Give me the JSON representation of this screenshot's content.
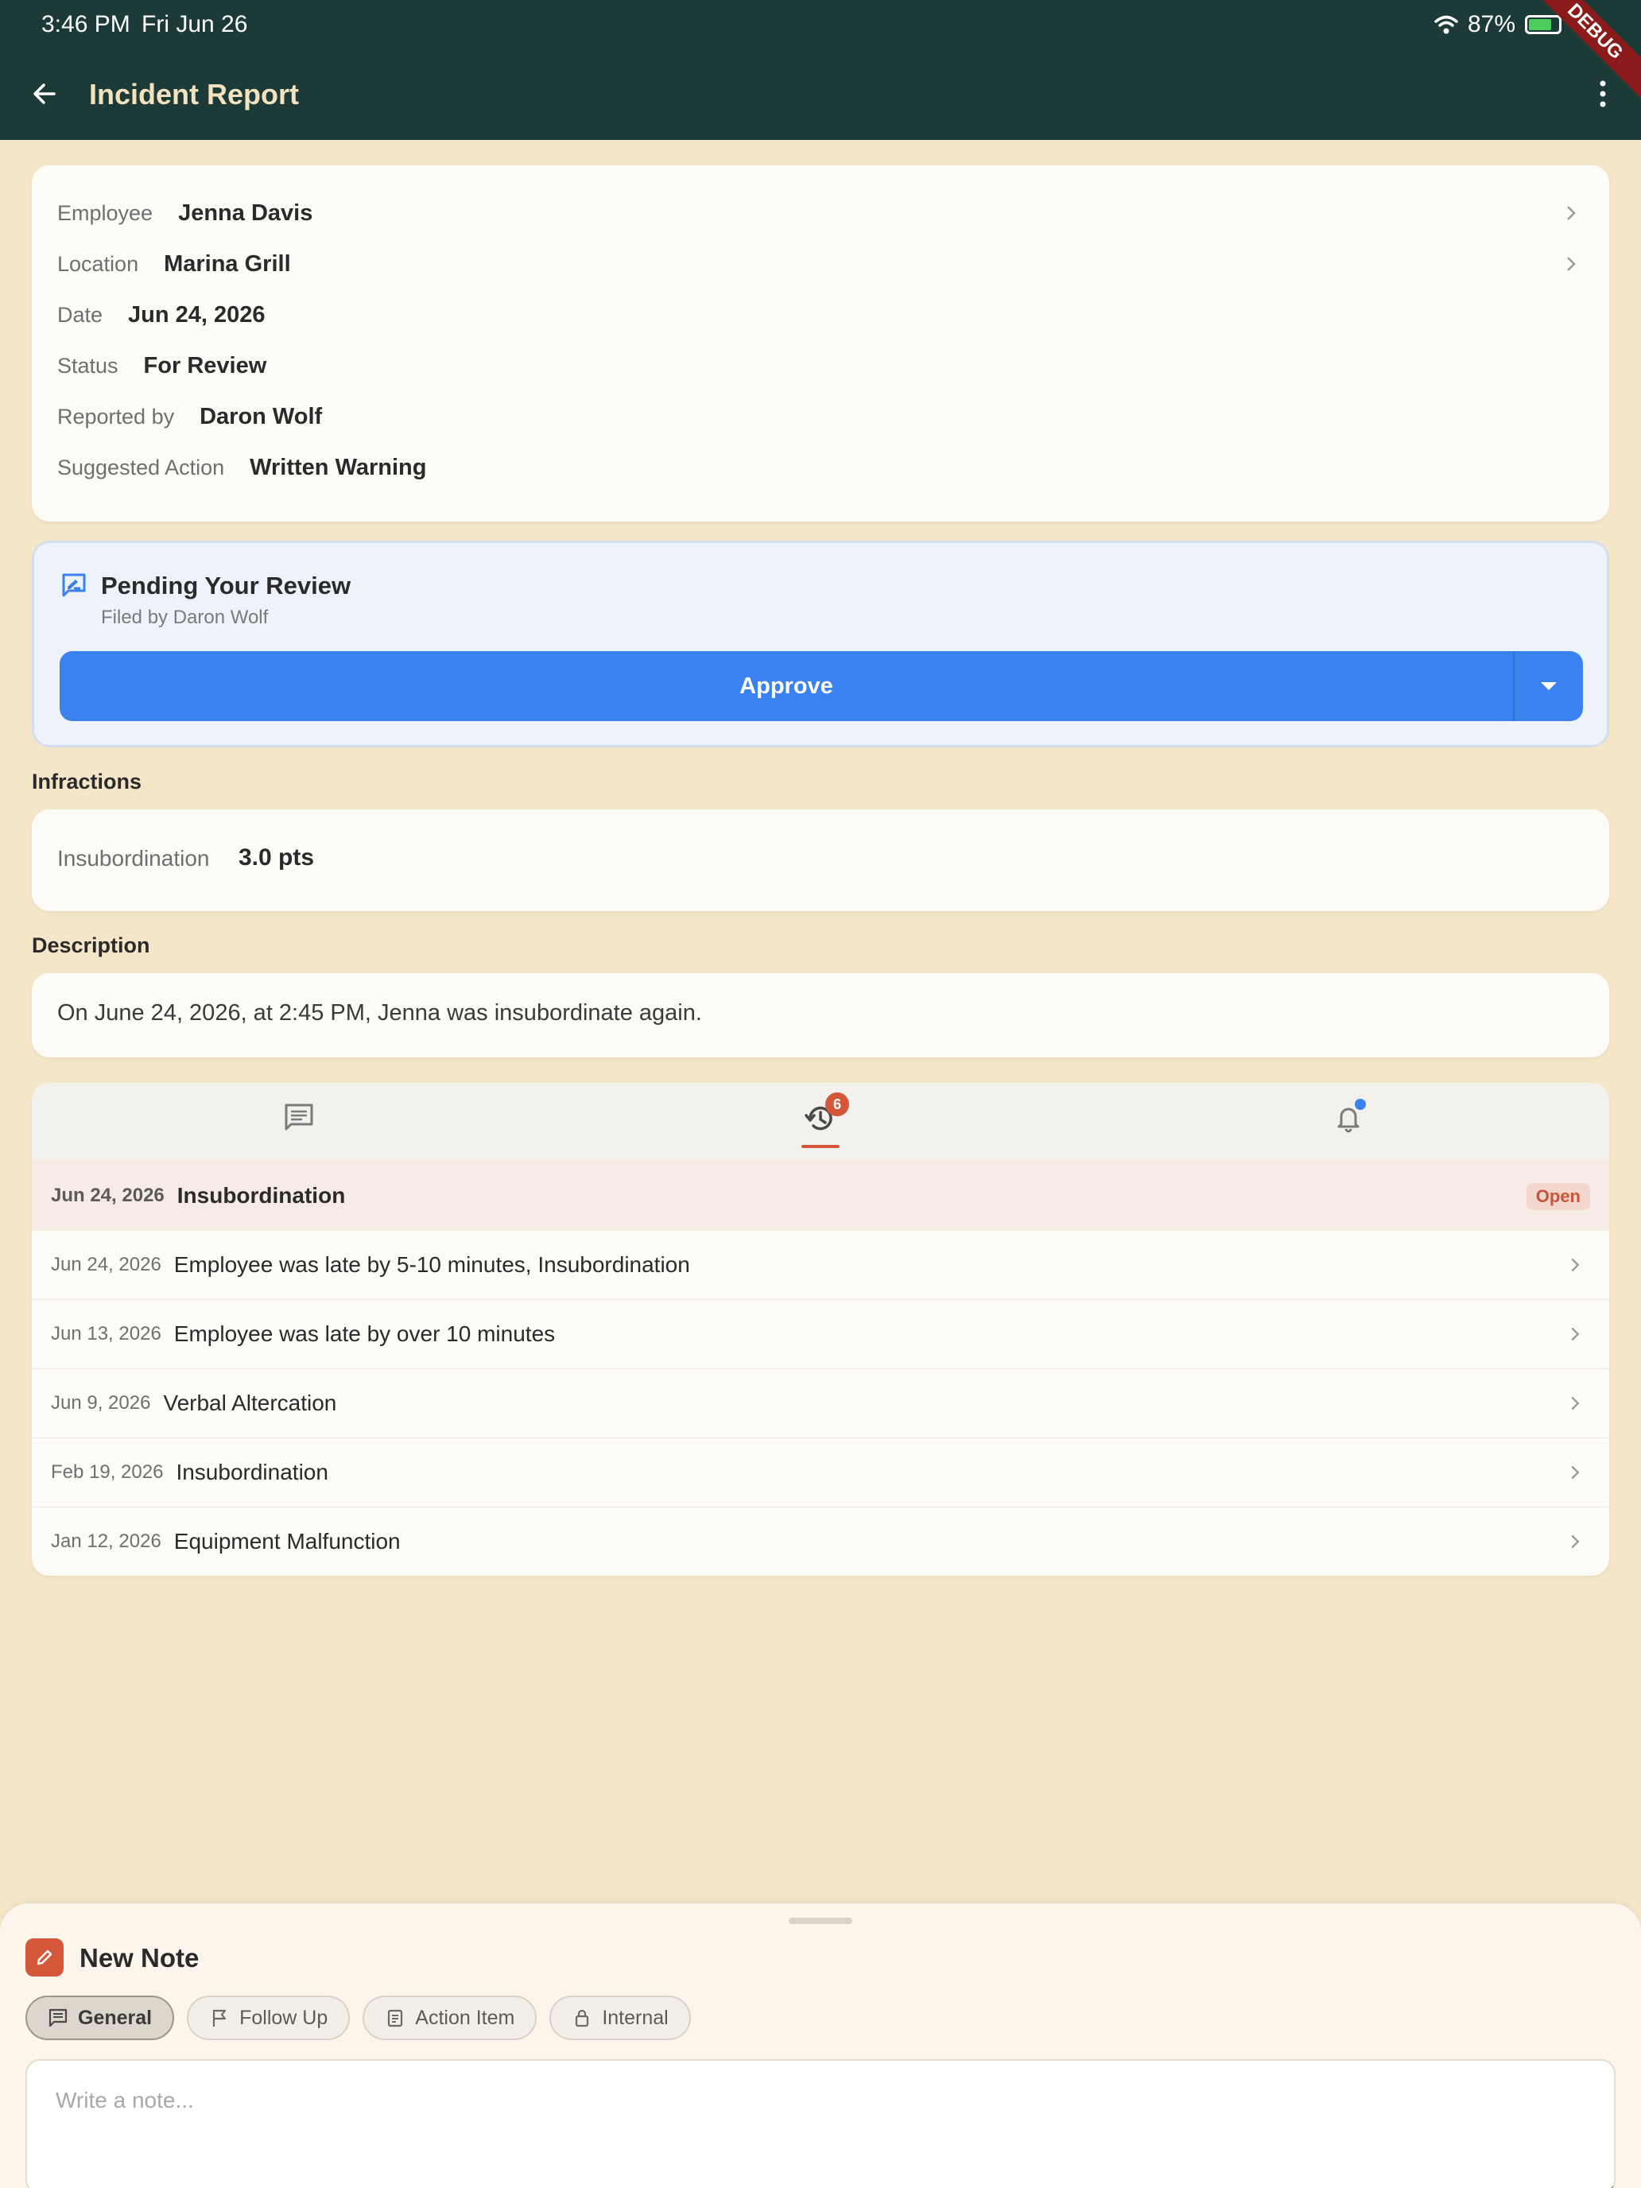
{
  "status_bar": {
    "time": "3:46 PM",
    "date": "Fri Jun 26",
    "battery": "87%",
    "debug": "DEBUG"
  },
  "app_bar": {
    "title": "Incident Report"
  },
  "details": [
    {
      "label": "Employee",
      "value": "Jenna Davis",
      "has_chevron": true
    },
    {
      "label": "Location",
      "value": "Marina Grill",
      "has_chevron": true
    },
    {
      "label": "Date",
      "value": "Jun 24, 2026",
      "has_chevron": false
    },
    {
      "label": "Status",
      "value": "For Review",
      "has_chevron": false
    },
    {
      "label": "Reported by",
      "value": "Daron Wolf",
      "has_chevron": false
    },
    {
      "label": "Suggested Action",
      "value": "Written Warning",
      "has_chevron": false
    }
  ],
  "review": {
    "title": "Pending Your Review",
    "subtitle": "Filed by Daron Wolf",
    "approve_label": "Approve"
  },
  "infractions": {
    "heading": "Infractions",
    "items": [
      {
        "label": "Insubordination",
        "value": "3.0 pts"
      }
    ]
  },
  "description": {
    "heading": "Description",
    "text": "On June 24, 2026, at 2:45 PM, Jenna was insubordinate again."
  },
  "history_tabs": {
    "icons": [
      "comments-icon",
      "history-icon",
      "notifications-icon"
    ],
    "active": "history-icon",
    "history_count": "6"
  },
  "history": {
    "current": {
      "date": "Jun 24, 2026",
      "title": "Insubordination",
      "badge": "Open"
    },
    "items": [
      {
        "date": "Jun 24, 2026",
        "title": "Employee was late by 5-10 minutes, Insubordination"
      },
      {
        "date": "Jun 13, 2026",
        "title": "Employee was late by over 10 minutes"
      },
      {
        "date": "Jun 9, 2026",
        "title": "Verbal Altercation"
      },
      {
        "date": "Feb 19, 2026",
        "title": "Insubordination"
      },
      {
        "date": "Jan 12, 2026",
        "title": "Equipment Malfunction"
      }
    ]
  },
  "new_note": {
    "title": "New Note",
    "chips": [
      {
        "label": "General",
        "icon": "message-icon",
        "selected": true
      },
      {
        "label": "Follow Up",
        "icon": "flag-icon",
        "selected": false
      },
      {
        "label": "Action Item",
        "icon": "clipboard-icon",
        "selected": false
      },
      {
        "label": "Internal",
        "icon": "lock-icon",
        "selected": false
      }
    ],
    "placeholder": "Write a note..."
  },
  "colors": {
    "app_bar": "#1c3a38",
    "background": "#f5e6c8",
    "accent": "#d4573a",
    "primary_button": "#3b82f0"
  }
}
